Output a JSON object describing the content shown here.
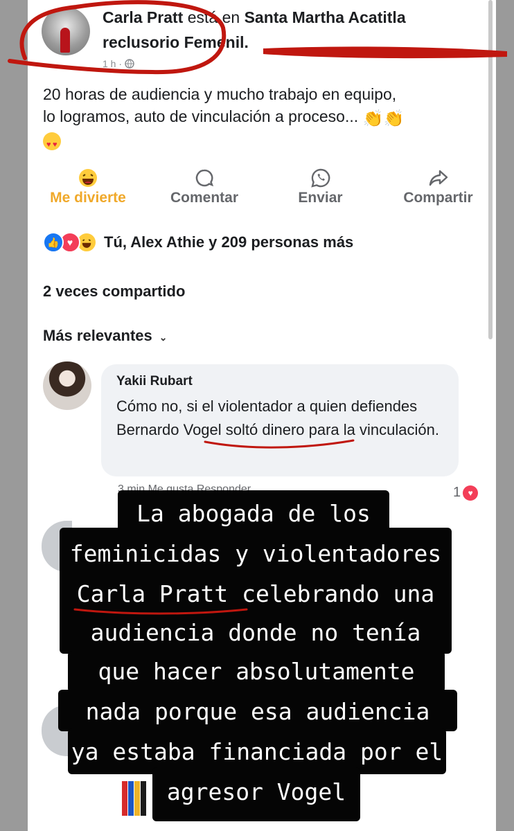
{
  "post": {
    "author": "Carla Pratt",
    "location_prefix": "está en",
    "location_name_line1": "Santa Martha Acatitla",
    "location_name_line2": "reclusorio Femenil.",
    "meta": "1 h · ",
    "text_line1": "20 horas de audiencia y mucho trabajo en equipo,",
    "text_line2": "lo logramos, auto de vinculación a proceso..."
  },
  "actions": {
    "react_label": "Me divierte",
    "comment_label": "Comentar",
    "send_label": "Enviar",
    "share_label": "Compartir"
  },
  "reactions": {
    "names": "Tú, Alex Athie y 209 personas más",
    "shares": "2 veces compartido"
  },
  "comments": {
    "sort_label": "Más relevantes",
    "items": [
      {
        "name": "Yakii Rubart",
        "text_part1": "Cómo no, si el violentador a quien defiendes ",
        "text_highlight": "Bernardo Vogel",
        "text_part2": " soltó dinero para la vinculación.",
        "meta": "3 min   Me gusta   Responder",
        "likes": "1"
      }
    ]
  },
  "story_caption": {
    "lines": [
      "La abogada de los",
      "feminicidas y violentadores",
      "Carla Pratt celebrando una",
      "audiencia donde no tenía",
      "que hacer absolutamente",
      "nada porque esa audiencia",
      "ya estaba financiada por el",
      "agresor Vogel"
    ]
  },
  "colors": {
    "annotation_red": "#c0170f",
    "reaction_yellow": "#f0a92b",
    "like_blue": "#1877f2",
    "love_red": "#f33e58"
  }
}
